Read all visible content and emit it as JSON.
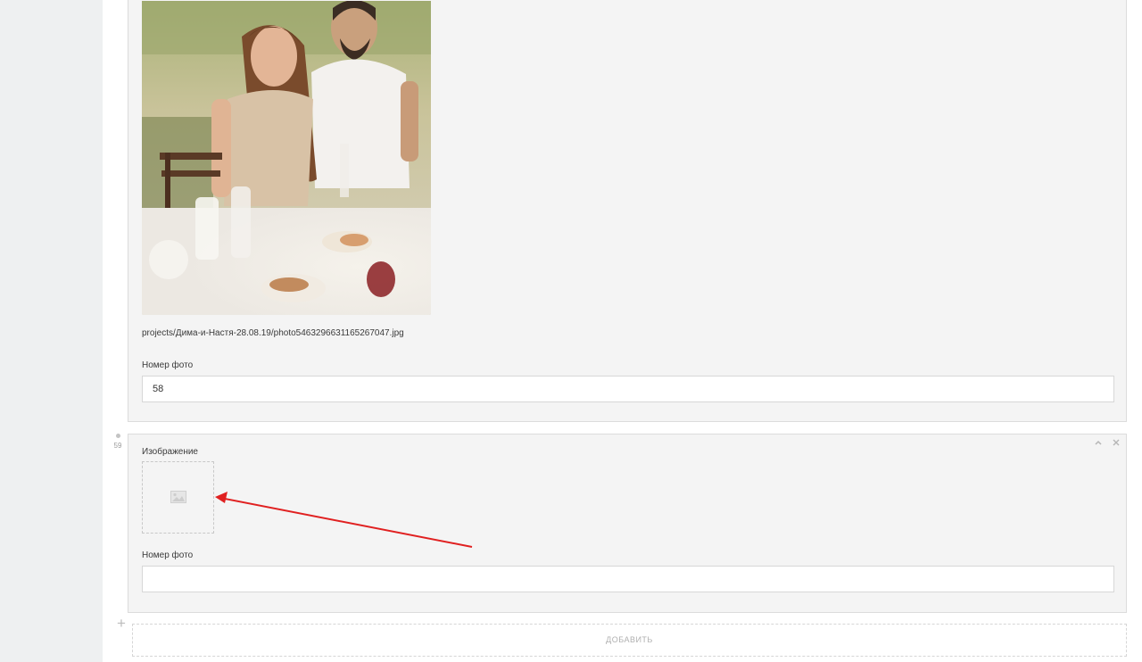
{
  "rows": [
    {
      "image": {
        "file_path": "projects/Дима-и-Настя-28.08.19/photo5463296631165267047.jpg"
      },
      "photo_number": {
        "label": "Номер фото",
        "value": "58"
      }
    },
    {
      "index": "59",
      "image": {
        "label": "Изображение",
        "placeholder_icon": "image-icon"
      },
      "photo_number": {
        "label": "Номер фото",
        "value": ""
      },
      "controls": {
        "collapse_icon": "chevron-up-icon",
        "remove_icon": "close-icon"
      }
    }
  ],
  "add_button": {
    "label": "ДОБАВИТЬ",
    "icon": "plus-icon"
  },
  "colors": {
    "annotation_arrow": "#e02020",
    "card_bg": "#f4f4f4",
    "gutter_bg": "#eef0f1"
  }
}
